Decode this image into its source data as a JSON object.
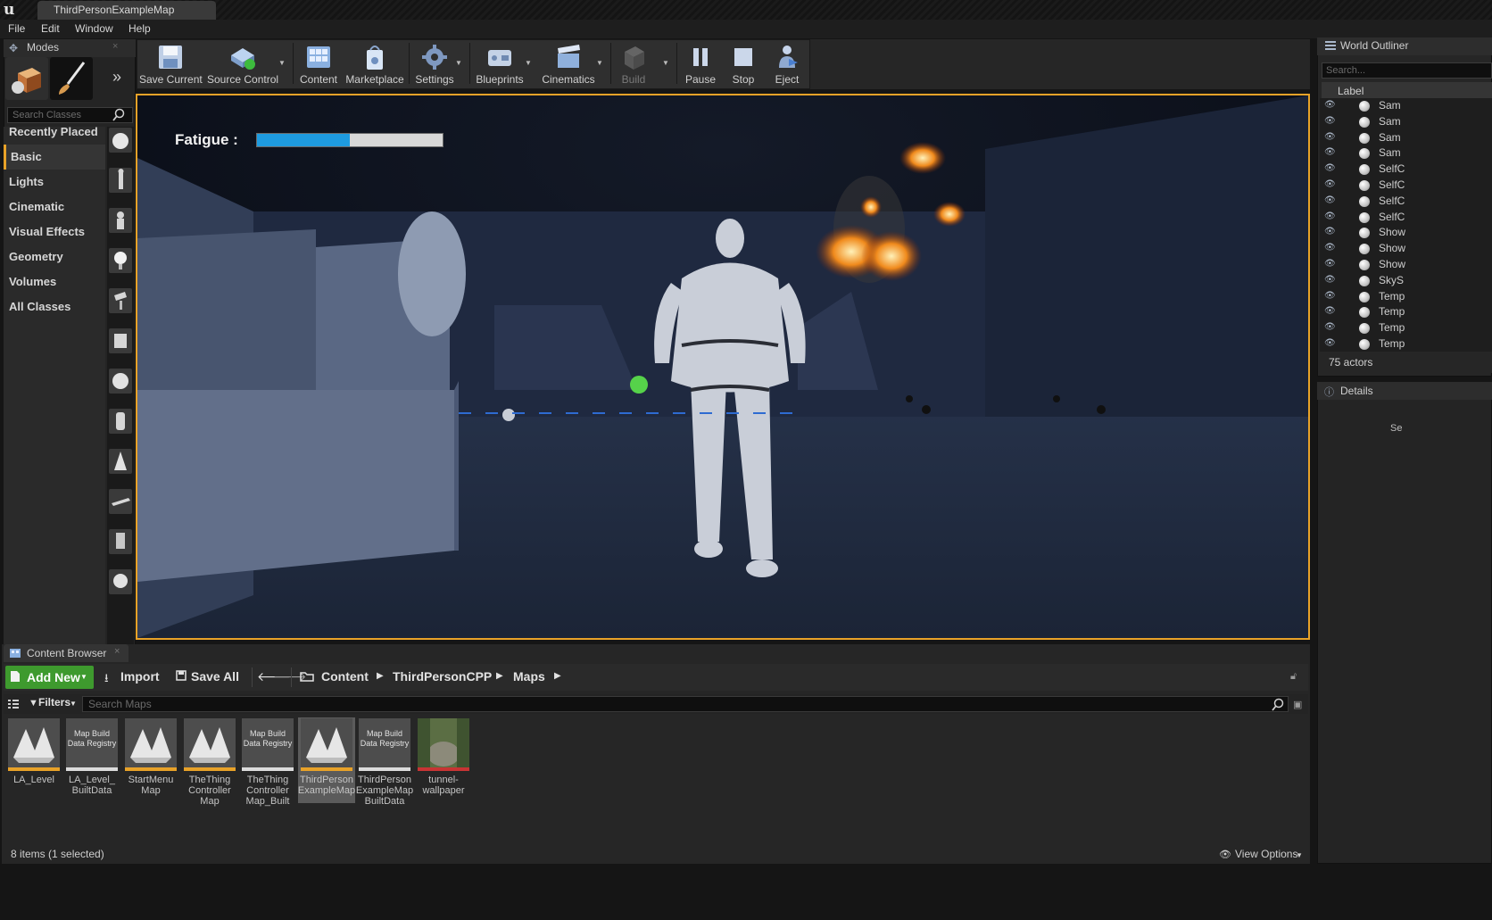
{
  "window": {
    "doc_tab": "ThirdPersonExampleMap"
  },
  "menu": [
    "File",
    "Edit",
    "Window",
    "Help"
  ],
  "modes": {
    "title": "Modes",
    "search_placeholder": "Search Classes",
    "categories": [
      "Recently Placed",
      "Basic",
      "Lights",
      "Cinematic",
      "Visual Effects",
      "Geometry",
      "Volumes",
      "All Classes"
    ],
    "selected_category": "Basic"
  },
  "toolbar": {
    "save_current": "Save Current",
    "source_control": "Source Control",
    "content": "Content",
    "marketplace": "Marketplace",
    "settings": "Settings",
    "blueprints": "Blueprints",
    "cinematics": "Cinematics",
    "build": "Build",
    "pause": "Pause",
    "stop": "Stop",
    "eject": "Eject"
  },
  "viewport": {
    "hud_label": "Fatigue :",
    "fatigue_fraction": 0.5
  },
  "outliner": {
    "title": "World Outliner",
    "search_placeholder": "Search...",
    "column_label": "Label",
    "rows": [
      "Sam",
      "Sam",
      "Sam",
      "Sam",
      "SelfC",
      "SelfC",
      "SelfC",
      "SelfC",
      "Show",
      "Show",
      "Show",
      "SkyS",
      "Temp",
      "Temp",
      "Temp",
      "Temp"
    ],
    "actor_count": "75 actors"
  },
  "details": {
    "title": "Details",
    "edge_text": "Se"
  },
  "content_browser": {
    "title": "Content Browser",
    "add_new": "Add New",
    "import": "Import",
    "save_all": "Save All",
    "breadcrumb": [
      "Content",
      "ThirdPersonCPP",
      "Maps"
    ],
    "filters": "Filters",
    "search_placeholder": "Search Maps",
    "registry_label": "Map Build Data Registry",
    "assets": [
      "LA_Level",
      "LA_Level_ BuiltData",
      "StartMenu Map",
      "TheThing Controller Map",
      "TheThing Controller Map_Built",
      "ThirdPerson ExampleMap",
      "ThirdPerson ExampleMap BuiltData",
      "tunnel- wallpaper"
    ],
    "status": "8 items (1 selected)",
    "view_options": "View Options"
  },
  "colors": {
    "accent": "#e8a228",
    "add_new": "#3e9a2e",
    "fatigue_fill": "#1e9be0"
  }
}
